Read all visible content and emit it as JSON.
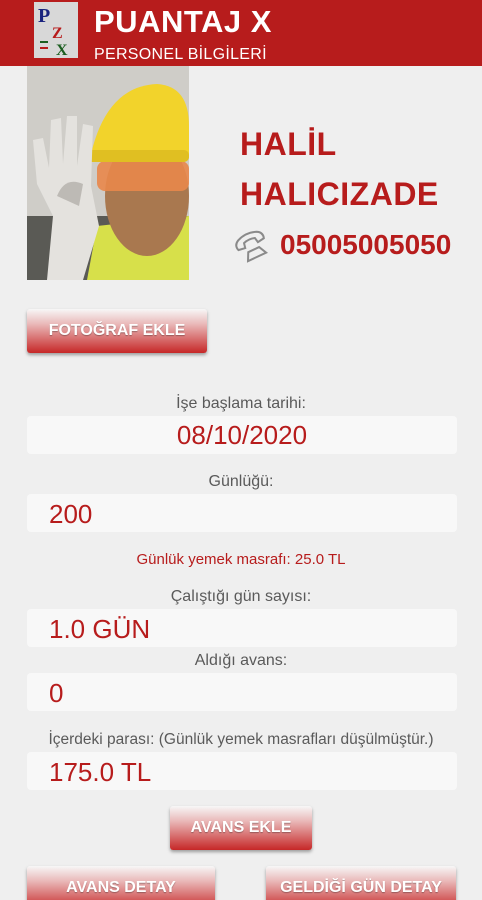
{
  "header": {
    "title": "PUANTAJ X",
    "subtitle": "PERSONEL BİLGİLERİ",
    "logo_letters": [
      "P",
      "Z",
      "X"
    ]
  },
  "person": {
    "first_name": "HALİL",
    "last_name": "HALICIZADE",
    "phone": "05005005050"
  },
  "buttons": {
    "add_photo": "FOTOĞRAF EKLE",
    "add_advance": "AVANS EKLE",
    "advance_detail": "AVANS DETAY",
    "days_detail": "GELDİĞİ GÜN DETAY"
  },
  "fields": {
    "start_date": {
      "label": "İşe başlama tarihi:",
      "value": "08/10/2020"
    },
    "daily_wage": {
      "label": "Günlüğü:",
      "value": "200"
    },
    "meal_cost": "Günlük yemek masrafı:  25.0 TL",
    "days_worked": {
      "label": "Çalıştığı gün sayısı:",
      "value": "1.0  GÜN"
    },
    "advance": {
      "label": "Aldığı avans:",
      "value": "0"
    },
    "balance": {
      "label": "İçerdeki parası: (Günlük yemek masrafları düşülmüştür.)",
      "value": "175.0 TL"
    }
  },
  "colors": {
    "primary": "#b71c1c",
    "background": "#efefef",
    "field": "#f8f8f8"
  },
  "icons": {
    "phone": "phone-icon"
  }
}
